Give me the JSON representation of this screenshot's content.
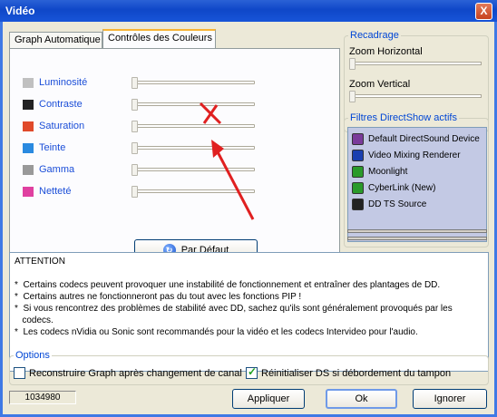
{
  "window": {
    "title": "Vidéo",
    "close_label": "X"
  },
  "tabs": [
    {
      "label": "Graph Automatique"
    },
    {
      "label": "Contrôles des Couleurs"
    }
  ],
  "color_controls": [
    {
      "label": "Luminosité",
      "icon": "luminosity-icon",
      "value": 0
    },
    {
      "label": "Contraste",
      "icon": "contrast-icon",
      "value": 0
    },
    {
      "label": "Saturation",
      "icon": "saturation-icon",
      "value": 0
    },
    {
      "label": "Teinte",
      "icon": "hue-icon",
      "value": 0
    },
    {
      "label": "Gamma",
      "icon": "gamma-icon",
      "value": 0
    },
    {
      "label": "Netteté",
      "icon": "sharpness-icon",
      "value": 0
    }
  ],
  "default_button": {
    "label": "Par Défaut",
    "icon": "refresh-icon"
  },
  "recadrage": {
    "title": "Recadrage",
    "zoom_h_label": "Zoom Horizontal",
    "zoom_v_label": "Zoom Vertical"
  },
  "filters": {
    "title": "Filtres DirectShow actifs",
    "items": [
      {
        "label": "Default DirectSound Device",
        "icon": "speaker-icon"
      },
      {
        "label": "Video Mixing Renderer",
        "icon": "monitor-icon"
      },
      {
        "label": "Moonlight",
        "icon": "filter-icon"
      },
      {
        "label": "CyberLink (New)",
        "icon": "filter-icon"
      },
      {
        "label": "DD TS Source",
        "icon": "dd-icon"
      }
    ]
  },
  "attention": {
    "text": "ATTENTION\n\n*  Certains codecs peuvent provoquer une instabilité de fonctionnement et entraîner des plantages de DD.\n*  Certains autres ne fonctionneront pas du tout avec les fonctions PIP !\n*  Si vous rencontrez des problèmes de stabilité avec DD, sachez qu'ils sont généralement provoqués par les\n   codecs.\n*  Les codecs nVidia ou Sonic sont recommandés pour la vidéo et les codecs Intervideo pour l'audio."
  },
  "options": {
    "title": "Options",
    "rebuild_label": "Reconstruire Graph après changement de canal",
    "rebuild_checked": false,
    "reset_label": "Réinitialiser DS si débordement du tampon",
    "reset_checked": true
  },
  "status": {
    "value": "1034980"
  },
  "buttons": {
    "apply": "Appliquer",
    "ok": "Ok",
    "cancel": "Ignorer"
  },
  "colors": {
    "accent": "#0046d5",
    "title_bar": "#0f47c8",
    "annotation": "#e02020"
  }
}
